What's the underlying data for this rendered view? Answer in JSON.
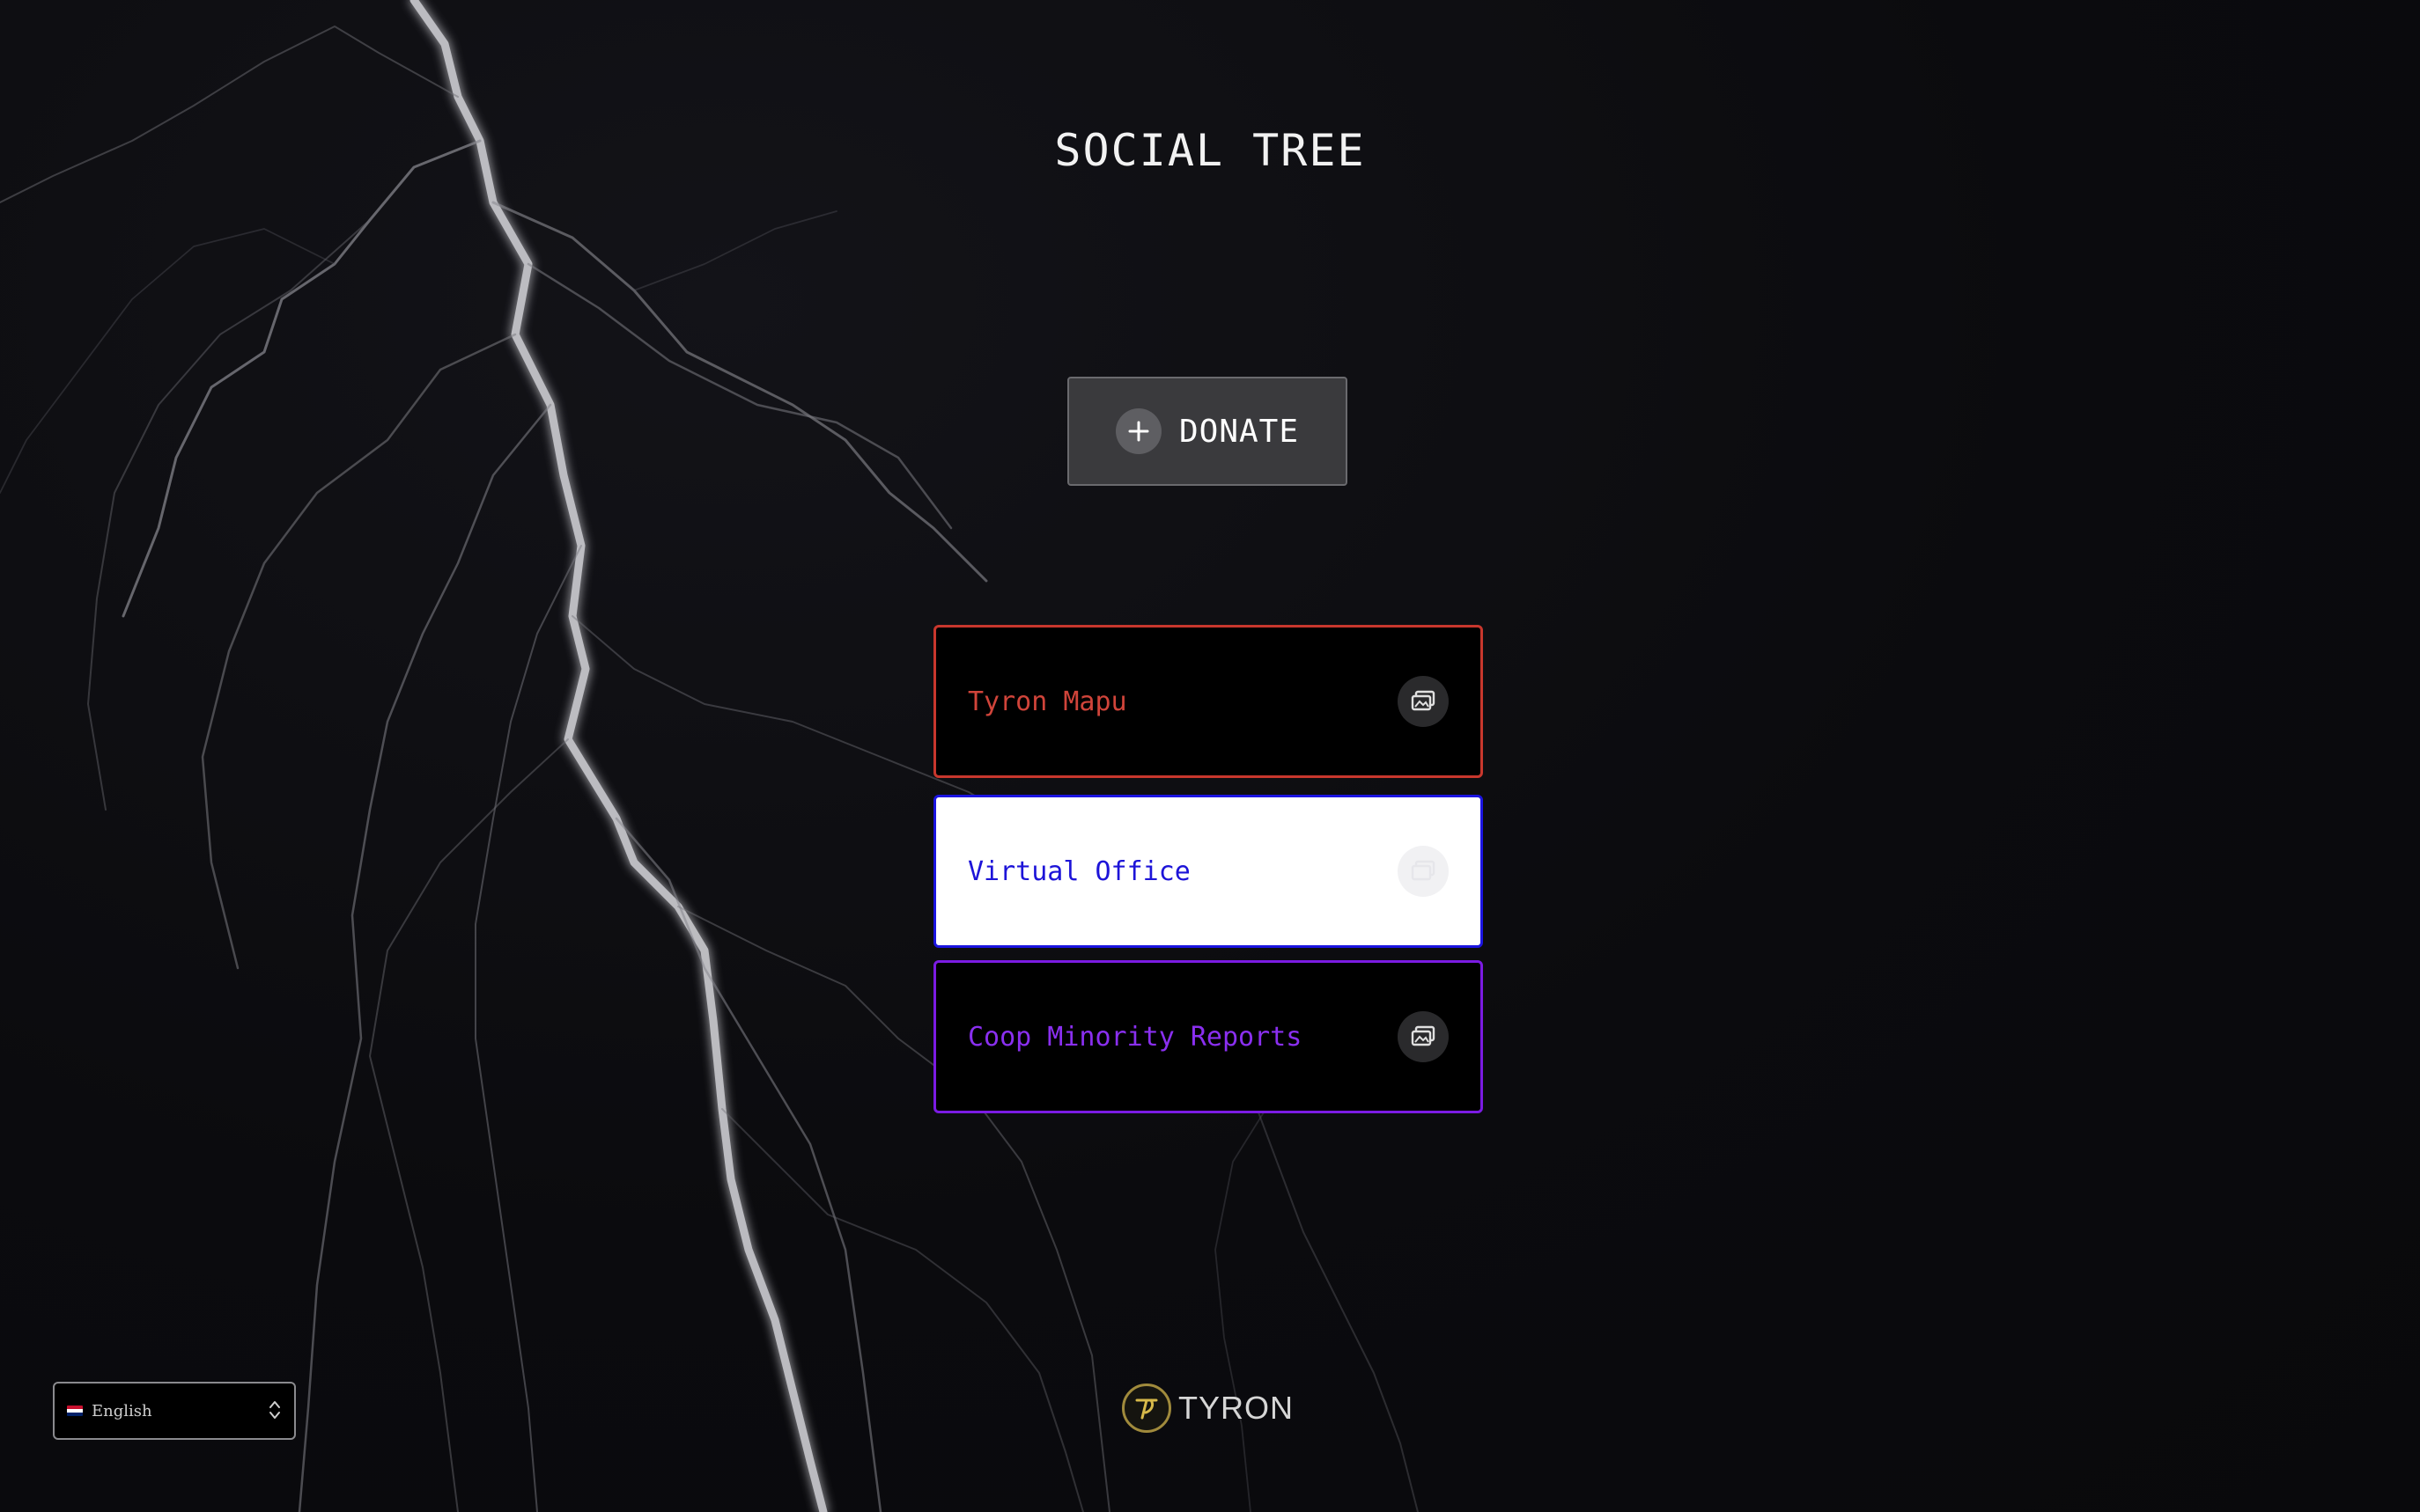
{
  "page": {
    "title": "SOCIAL TREE"
  },
  "donate": {
    "label": "DONATE",
    "icon": "plus-icon"
  },
  "links": [
    {
      "label": "Tyron Mapu",
      "border_color": "#c8372d",
      "text_color": "#d0443a",
      "background": "#000000",
      "icon": "external-link-icon"
    },
    {
      "label": "Virtual Office",
      "border_color": "#1b14e0",
      "text_color": "#1d14d8",
      "background": "#ffffff",
      "icon": "external-link-icon"
    },
    {
      "label": "Coop Minority Reports",
      "border_color": "#7b1be3",
      "text_color": "#8a2ff0",
      "background": "#000000",
      "icon": "external-link-icon"
    }
  ],
  "footer": {
    "brand": "TYRON",
    "logo_icon": "tyron-logo-icon"
  },
  "language_select": {
    "value": "English",
    "flag_icon": "uk-flag-icon",
    "chevron_icon": "up-down-chevron-icon"
  },
  "colors": {
    "background": "#0b0b0e",
    "donate_bg": "#3a3a3d"
  }
}
